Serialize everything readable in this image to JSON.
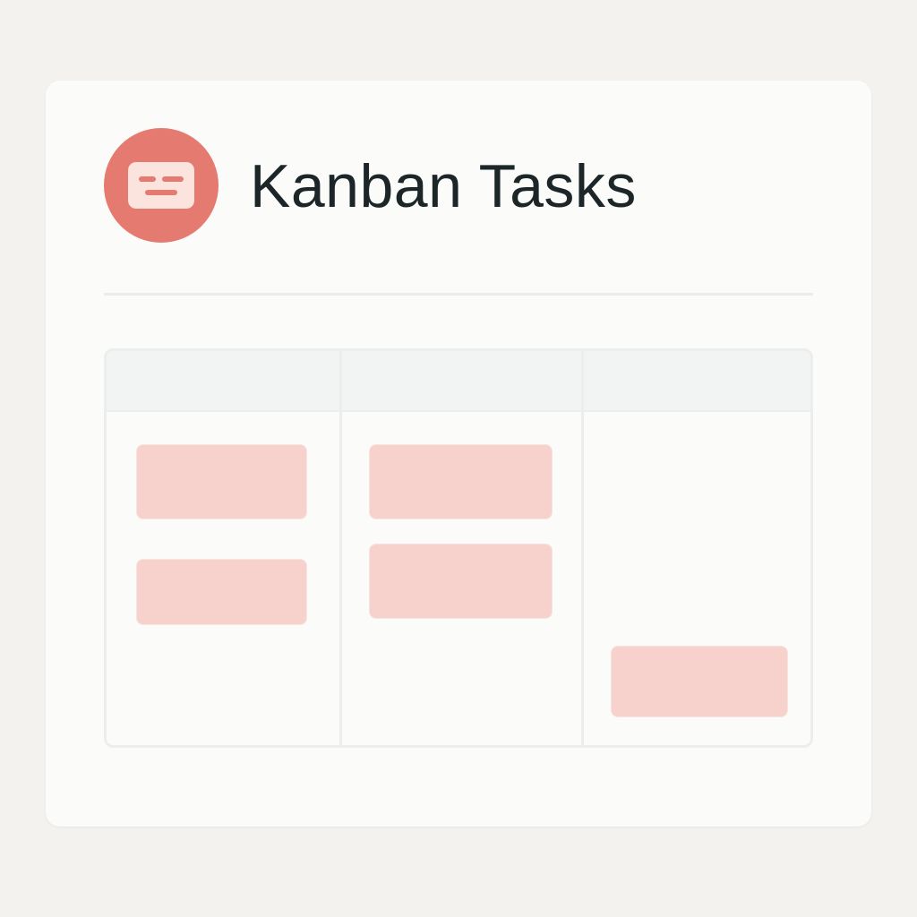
{
  "app": {
    "title": "Kanban Tasks",
    "logo_icon": "kanban-card-icon"
  },
  "colors": {
    "accent": "#e57a70",
    "card": "#f7d1cb",
    "logo_glyph": "#fbe3de"
  },
  "board": {
    "columns": [
      {
        "title": "",
        "cards": [
          {
            "label": ""
          },
          {
            "label": ""
          }
        ]
      },
      {
        "title": "",
        "cards": [
          {
            "label": ""
          },
          {
            "label": ""
          }
        ]
      },
      {
        "title": "",
        "cards": [
          {
            "label": ""
          }
        ]
      }
    ]
  }
}
